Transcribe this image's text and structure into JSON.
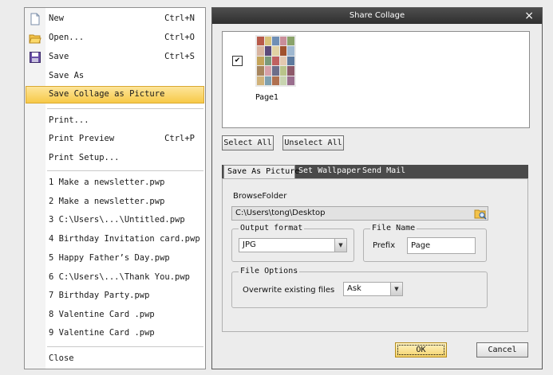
{
  "menu": {
    "items": [
      {
        "label": "New",
        "shortcut": "Ctrl+N",
        "icon": "new-document-icon"
      },
      {
        "label": "Open...",
        "shortcut": "Ctrl+O",
        "icon": "open-folder-icon"
      },
      {
        "label": "Save",
        "shortcut": "Ctrl+S",
        "icon": "save-disk-icon"
      },
      {
        "label": "Save As",
        "shortcut": ""
      },
      {
        "label": "Save Collage as Picture",
        "shortcut": ""
      },
      {
        "label": "Print...",
        "shortcut": ""
      },
      {
        "label": "Print Preview",
        "shortcut": "Ctrl+P"
      },
      {
        "label": "Print Setup...",
        "shortcut": ""
      },
      {
        "label": "1 Make a newsletter.pwp",
        "shortcut": ""
      },
      {
        "label": "2 Make a newsletter.pwp",
        "shortcut": ""
      },
      {
        "label": "3 C:\\Users\\...\\Untitled.pwp",
        "shortcut": ""
      },
      {
        "label": "4 Birthday Invitation card.pwp",
        "shortcut": ""
      },
      {
        "label": "5 Happy Father’s Day.pwp",
        "shortcut": ""
      },
      {
        "label": "6 C:\\Users\\...\\Thank You.pwp",
        "shortcut": ""
      },
      {
        "label": "7 Birthday Party.pwp",
        "shortcut": ""
      },
      {
        "label": "8 Valentine Card .pwp",
        "shortcut": ""
      },
      {
        "label": "9 Valentine Card .pwp",
        "shortcut": ""
      },
      {
        "label": "Close",
        "shortcut": ""
      }
    ]
  },
  "dialog": {
    "title": "Share Collage",
    "close_symbol": "×",
    "page_label": "Page1",
    "page_checked": true,
    "select_all": "Select All",
    "unselect_all": "Unselect All",
    "tabs": [
      "Save As Picture",
      "Set Wallpaper",
      "Send Mail"
    ],
    "browse_folder_label": "BrowseFolder",
    "folder_path": "C:\\Users\\tong\\Desktop",
    "output_format_legend": "Output format",
    "output_format_value": "JPG",
    "file_name_legend": "File Name",
    "prefix_label": "Prefix",
    "prefix_value": "Page",
    "file_options_legend": "File Options",
    "overwrite_label": "Overwrite existing files",
    "overwrite_value": "Ask",
    "ok": "OK",
    "cancel": "Cancel"
  },
  "colors": {
    "highlight": "#f7c948",
    "titlebar": "#3a3a3a",
    "tabbar": "#4a4a4a"
  }
}
